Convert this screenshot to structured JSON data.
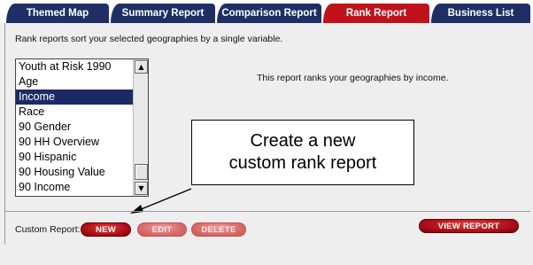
{
  "tabs": [
    {
      "label": "Themed Map",
      "active": false
    },
    {
      "label": "Summary Report",
      "active": false
    },
    {
      "label": "Comparison Report",
      "active": false
    },
    {
      "label": "Rank Report",
      "active": true
    },
    {
      "label": "Business List",
      "active": false
    }
  ],
  "intro_text": "Rank reports sort your selected geographies by a single variable.",
  "variable_list": {
    "items": [
      "Youth at Risk 1990",
      "Age",
      "Income",
      "Race",
      "90 Gender",
      "90 HH Overview",
      "90 Hispanic",
      "90 Housing Value",
      "90 Income"
    ],
    "selected": "Income"
  },
  "report_description": "This report ranks your geographies by income.",
  "callout": {
    "line1": "Create a new",
    "line2": "custom rank report"
  },
  "custom_report": {
    "label": "Custom Report:",
    "new_label": "NEW",
    "edit_label": "EDIT",
    "delete_label": "DELETE"
  },
  "view_report_label": "VIEW REPORT",
  "colors": {
    "tab": "#1f2f66",
    "tab_active": "#c1121c",
    "selection": "#1c2a66",
    "button": "#b0101a"
  }
}
